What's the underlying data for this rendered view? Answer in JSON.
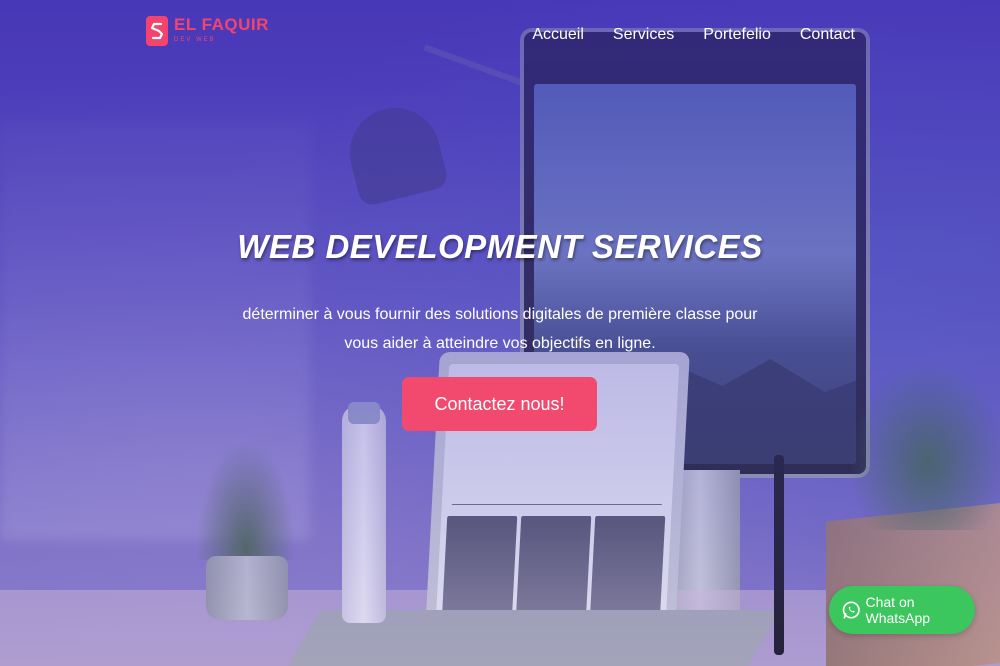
{
  "brand": {
    "name": "EL FAQUIR",
    "tagline": "DEV WEB",
    "color": "#f2446d"
  },
  "nav": {
    "items": [
      {
        "label": "Accueil"
      },
      {
        "label": "Services"
      },
      {
        "label": "Portefelio"
      },
      {
        "label": "Contact"
      }
    ]
  },
  "hero": {
    "title": "WEB DEVELOPMENT SERVICES",
    "text_line1": "déterminer à vous fournir des solutions digitales de première classe pour",
    "text_line2": "vous aider à atteindre vos objectifs en ligne.",
    "cta_label": "Contactez nous!",
    "cta_color": "#f24a6e",
    "overlay_color": "#4632be"
  },
  "whatsapp": {
    "label": "Chat on WhatsApp",
    "color": "#3bc65e",
    "icon": "whatsapp-icon"
  }
}
